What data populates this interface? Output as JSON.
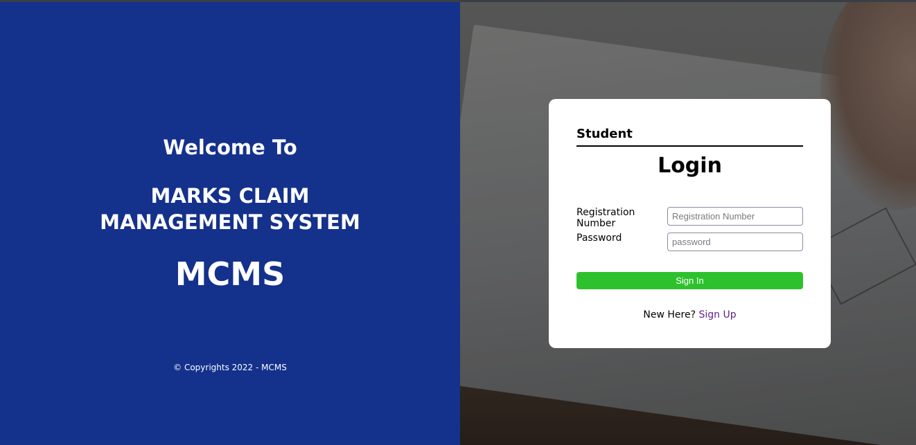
{
  "left": {
    "welcome": "Welcome To",
    "system_name_line1": "MARKS CLAIM",
    "system_name_line2": "MANAGEMENT SYSTEM",
    "acronym": "MCMS",
    "copyright": "© Copyrights 2022 - MCMS",
    "background_color": "#14318c"
  },
  "login": {
    "role_title": "Student",
    "title": "Login",
    "registration_label": "Registration Number",
    "registration_placeholder": "Registration Number",
    "password_label": "Password",
    "password_placeholder": "password",
    "signin_label": "Sign In",
    "signup_prompt": "New Here?",
    "signup_link": "Sign Up",
    "signin_color": "#2dc22d",
    "link_color": "#5a1f8c"
  }
}
